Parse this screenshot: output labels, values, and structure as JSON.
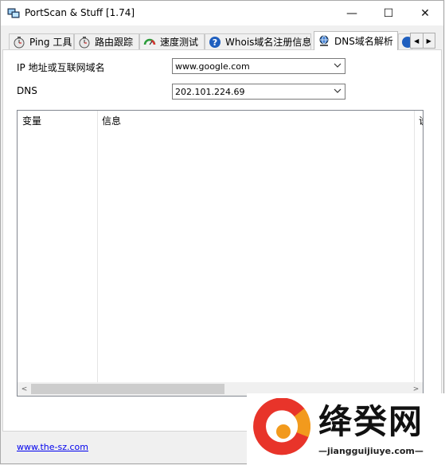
{
  "window": {
    "title": "PortScan & Stuff [1.74]"
  },
  "titlebar_buttons": {
    "minimize": "—",
    "maximize": "☐",
    "close": "✕"
  },
  "tabs": [
    {
      "label": "Ping 工具",
      "icon": "stopwatch-icon"
    },
    {
      "label": "路由跟踪",
      "icon": "stopwatch-icon"
    },
    {
      "label": "速度测试",
      "icon": "speedometer-icon"
    },
    {
      "label": "Whois域名注册信息",
      "icon": "question-icon"
    },
    {
      "label": "DNS域名解析",
      "icon": "network-icon",
      "active": true
    }
  ],
  "tab_scroll": {
    "left": "◀",
    "right": "▶"
  },
  "form": {
    "host_label": "IP 地址或互联网域名",
    "host_value": "www.google.com",
    "dns_label": "DNS",
    "dns_value": "202.101.224.69"
  },
  "results": {
    "columns": [
      "变量",
      "信息",
      "说"
    ],
    "scroll_left": "<",
    "scroll_right": ">"
  },
  "footer": {
    "link": "www.the-sz.com"
  },
  "watermark": {
    "text": "绛癸网",
    "url": "—jiangguijiuye.com—"
  }
}
